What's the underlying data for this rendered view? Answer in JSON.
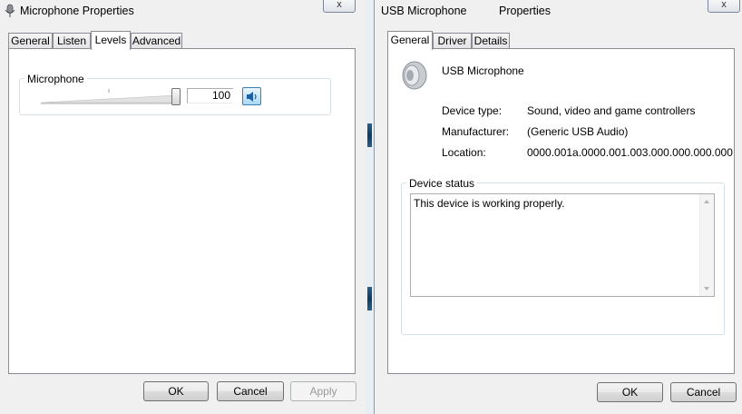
{
  "left_window": {
    "title": "Microphone Properties",
    "close_label": "x",
    "tabs": [
      "General",
      "Listen",
      "Levels",
      "Advanced"
    ],
    "active_tab": "Levels",
    "levels": {
      "group_label": "Microphone",
      "value": "100",
      "slider_level": 1.0
    },
    "buttons": {
      "ok": "OK",
      "cancel": "Cancel",
      "apply": "Apply"
    }
  },
  "right_window": {
    "title_device": "USB Microphone",
    "title_suffix": "Properties",
    "close_label": "x",
    "tabs": [
      "General",
      "Driver",
      "Details"
    ],
    "active_tab": "General",
    "device_name": "USB Microphone",
    "fields": [
      {
        "label": "Device type:",
        "value": "Sound, video and game controllers"
      },
      {
        "label": "Manufacturer:",
        "value": "(Generic USB Audio)"
      },
      {
        "label": "Location:",
        "value": "0000.001a.0000.001.003.000.000.000.000"
      }
    ],
    "status_group_label": "Device status",
    "status_text": "This device is working properly.",
    "buttons": {
      "ok": "OK",
      "cancel": "Cancel"
    }
  },
  "icons": {
    "left_title_icon": "microphone-icon",
    "device_icon": "speaker-device-icon",
    "mute_icon": "speaker-volume-icon"
  },
  "colors": {
    "accent": "#1f5fa6",
    "window_bg": "#f0f0f0",
    "panel_bg": "#ffffff"
  }
}
